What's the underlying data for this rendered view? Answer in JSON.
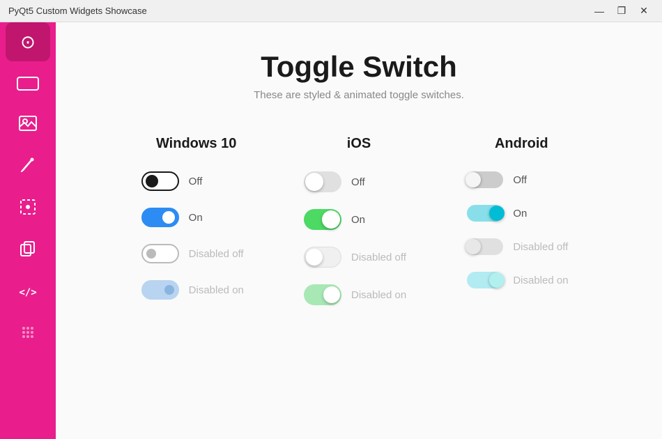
{
  "titlebar": {
    "title": "PyQt5 Custom Widgets Showcase",
    "min": "—",
    "max": "❐",
    "close": "✕"
  },
  "sidebar": {
    "items": [
      {
        "name": "toggle-icon",
        "symbol": "⊙"
      },
      {
        "name": "card-icon",
        "symbol": "▭"
      },
      {
        "name": "image-icon",
        "symbol": "🖼"
      },
      {
        "name": "picker-icon",
        "symbol": "✏"
      },
      {
        "name": "select-icon",
        "symbol": "⬚"
      },
      {
        "name": "copy-icon",
        "symbol": "❒"
      },
      {
        "name": "code-icon",
        "symbol": "</>"
      },
      {
        "name": "dots-icon",
        "symbol": "⠿"
      }
    ]
  },
  "main": {
    "title": "Toggle Switch",
    "subtitle": "These are styled & animated toggle switches.",
    "columns": [
      {
        "header": "Windows 10",
        "rows": [
          {
            "label": "Off",
            "state": "off"
          },
          {
            "label": "On",
            "state": "on"
          },
          {
            "label": "Disabled off",
            "state": "disabled-off"
          },
          {
            "label": "Disabled on",
            "state": "disabled-on"
          }
        ]
      },
      {
        "header": "iOS",
        "rows": [
          {
            "label": "Off",
            "state": "off"
          },
          {
            "label": "On",
            "state": "on"
          },
          {
            "label": "Disabled off",
            "state": "disabled-off"
          },
          {
            "label": "Disabled on",
            "state": "disabled-on"
          }
        ]
      },
      {
        "header": "Android",
        "rows": [
          {
            "label": "Off",
            "state": "off"
          },
          {
            "label": "On",
            "state": "on"
          },
          {
            "label": "Disabled off",
            "state": "disabled-off"
          },
          {
            "label": "Disabled on",
            "state": "disabled-on"
          }
        ]
      }
    ]
  }
}
